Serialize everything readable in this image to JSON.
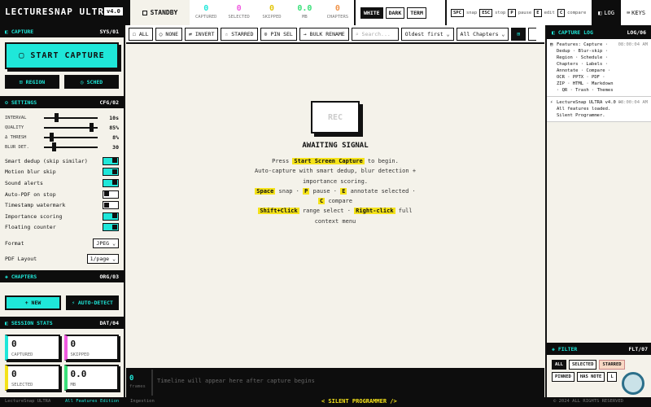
{
  "header": {
    "logo": "LECTURESNAP ULTRA",
    "version": "v4.0",
    "standby": "STANDBY",
    "stats": [
      {
        "value": "0",
        "label": "CAPTURED",
        "color": "#1fe7d9"
      },
      {
        "value": "0",
        "label": "SELECTED",
        "color": "#f05ae0"
      },
      {
        "value": "0",
        "label": "SKIPPED",
        "color": "#f4e21a"
      },
      {
        "value": "0.0",
        "label": "MB",
        "color": "#3ae07a"
      },
      {
        "value": "0",
        "label": "CHAPTERS",
        "color": "#f0944a"
      }
    ],
    "themes": [
      "WHITE",
      "DARK",
      "TERM"
    ],
    "keys": [
      {
        "key": "SPC",
        "label": "snap"
      },
      {
        "key": "ESC",
        "label": "stop"
      },
      {
        "key": "P",
        "label": "pause"
      },
      {
        "key": "E",
        "label": "edit"
      },
      {
        "key": "C",
        "label": "compare"
      }
    ],
    "log_label": "LOG",
    "keys_label": "KEYS"
  },
  "capture": {
    "title": "CAPTURE",
    "code": "SYS/01",
    "start": "START CAPTURE",
    "region": "REGION",
    "sched": "SCHED"
  },
  "settings": {
    "title": "SETTINGS",
    "code": "CFG/02",
    "sliders": [
      {
        "label": "INTERVAL",
        "value": "10s",
        "pos": 0.2
      },
      {
        "label": "QUALITY",
        "value": "85%",
        "pos": 0.85
      },
      {
        "label": "Δ THRESH",
        "value": "8%",
        "pos": 0.1
      },
      {
        "label": "BLUR DET.",
        "value": "30",
        "pos": 0.15
      }
    ],
    "toggles": [
      {
        "label": "Smart dedup (skip similar)",
        "on": true
      },
      {
        "label": "Motion blur skip",
        "on": true
      },
      {
        "label": "Sound alerts",
        "on": true
      },
      {
        "label": "Auto-PDF on stop",
        "on": false
      },
      {
        "label": "Timestamp watermark",
        "on": false
      },
      {
        "label": "Importance scoring",
        "on": true
      },
      {
        "label": "Floating counter",
        "on": true
      }
    ],
    "format_label": "Format",
    "format_value": "JPEG",
    "pdf_label": "PDF Layout",
    "pdf_value": "1/page"
  },
  "chapters": {
    "title": "CHAPTERS",
    "code": "ORG/03",
    "new": "+ NEW",
    "auto": "AUTO-DETECT"
  },
  "session": {
    "title": "SESSION STATS",
    "code": "DAT/04",
    "cards": [
      {
        "value": "0",
        "label": "CAPTURED"
      },
      {
        "value": "0",
        "label": "SKIPPED"
      },
      {
        "value": "0",
        "label": "SELECTED"
      },
      {
        "value": "0.0",
        "label": "MB"
      }
    ]
  },
  "toolbar": {
    "all": "ALL",
    "none": "NONE",
    "invert": "INVERT",
    "starred": "STARRED",
    "pinsel": "PIN SEL",
    "bulk": "BULK RENAME",
    "search_placeholder": "Search...",
    "sort": "Oldest first",
    "chapters": "All Chapters"
  },
  "empty": {
    "rec": "REC",
    "title": "AWAITING SIGNAL",
    "l1a": "Press ",
    "l1b": "Start Screen Capture",
    "l1c": " to begin.",
    "l2": "Auto-capture with smart dedup, blur detection +",
    "l3": "importance scoring.",
    "k_space": "Space",
    "t_snap": " snap · ",
    "k_p": "P",
    "t_pause": " pause · ",
    "k_e": "E",
    "t_annotate": " annotate selected · ",
    "k_c": "C",
    "t_compare": " compare",
    "k_shift": "Shift+Click",
    "t_range": " range select · ",
    "k_right": "Right-click",
    "t_full": " full",
    "l_context": "context menu"
  },
  "timeline": {
    "count": "0",
    "frames": "frames",
    "text": "Timeline will appear here after capture begins"
  },
  "log": {
    "title": "CAPTURE LOG",
    "code": "LOG/06",
    "entries": [
      {
        "time": "08:00:04 AM",
        "text": "Features: Capture · Dedup · Blur-skip · Region · Schedule · Chapters · Labels · Annotate · Compare · OCR · PPTX · PDF · ZIP · HTML · Markdown · QR · Trash · Themes"
      },
      {
        "time": "08:00:04 AM",
        "text": "LectureSnap ULTRA v4.0 — All features loaded. Silent Programmer."
      }
    ]
  },
  "filter": {
    "title": "FILTER",
    "code": "FLT/07",
    "buttons": [
      "ALL",
      "SELECTED",
      "STARRED",
      "PINNED",
      "HAS NOTE",
      "L"
    ]
  },
  "footer": {
    "left": "LectureSnap ULTRA",
    "left2": "All Features Edition",
    "left3": "Ingestion",
    "center": "< SILENT PROGRAMMER />",
    "right": "© 2024 ALL RIGHTS RESERVED"
  }
}
